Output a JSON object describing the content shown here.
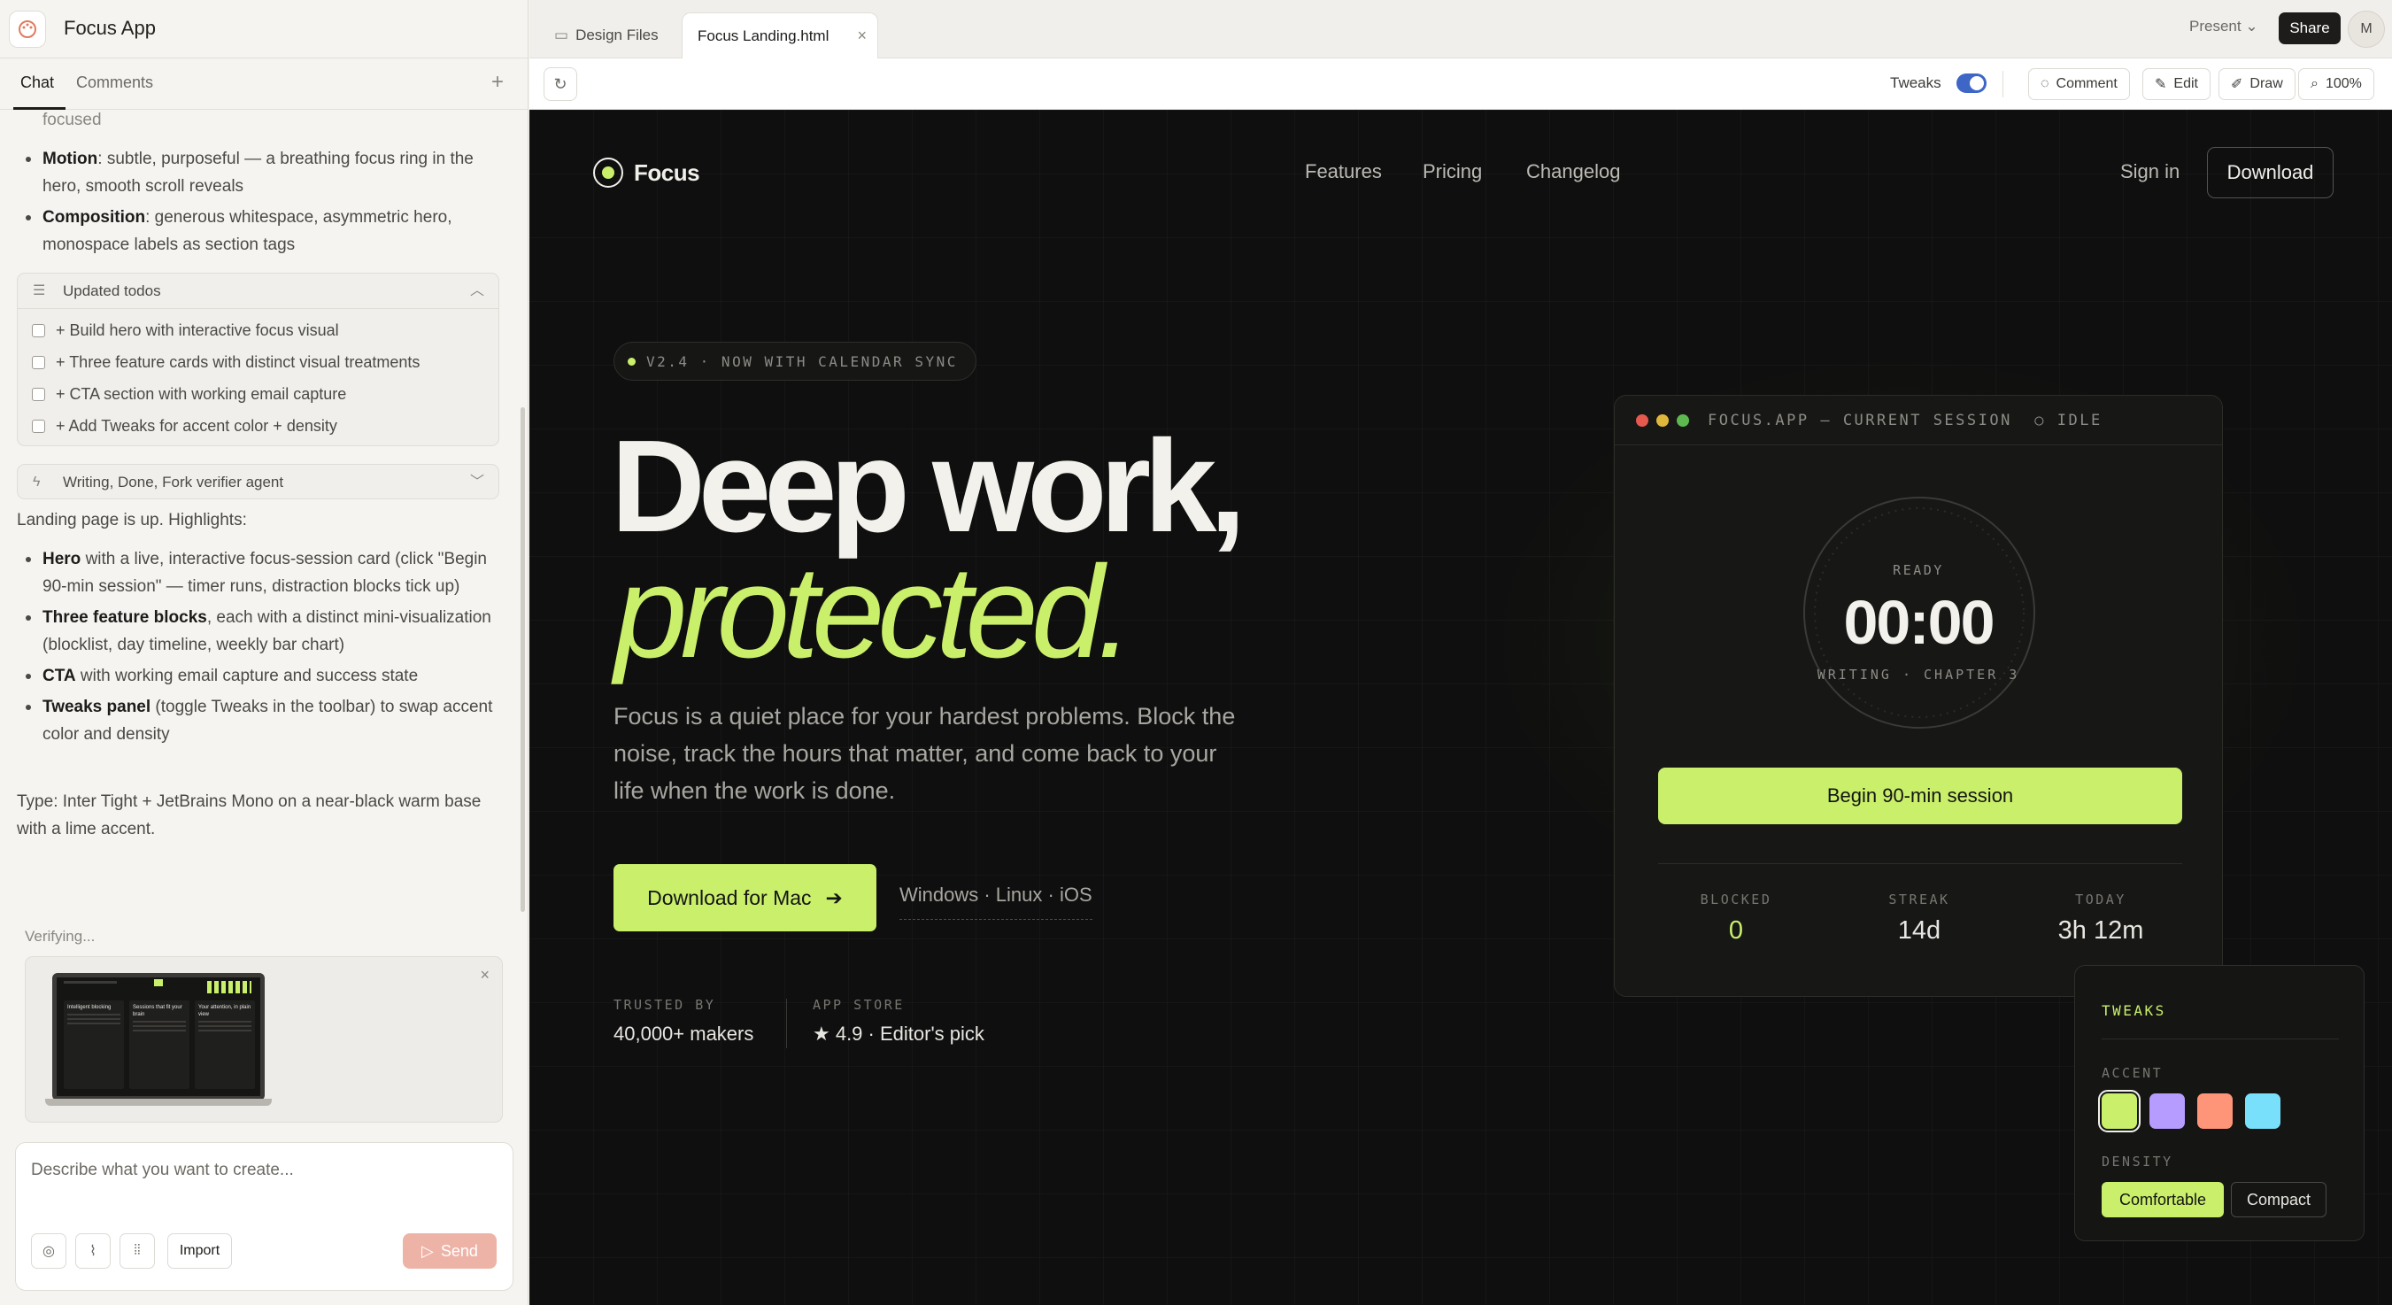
{
  "app": {
    "title": "Focus App"
  },
  "panel": {
    "tabs": [
      "Chat",
      "Comments"
    ],
    "plus": "+",
    "partial_top": "focused",
    "design_bullets": [
      {
        "bold": "Motion",
        "text": ": subtle, purposeful — a breathing focus ring in the hero, smooth scroll reveals"
      },
      {
        "bold": "Composition",
        "text": ": generous whitespace, asymmetric hero, monospace labels as section tags"
      }
    ],
    "todos": {
      "title": "Updated todos",
      "items": [
        "+ Build hero with interactive focus visual",
        "+ Three feature cards with distinct visual treatments",
        "+ CTA section with working email capture",
        "+ Add Tweaks for accent color + density"
      ]
    },
    "agent": {
      "title": "Writing, Done, Fork verifier agent"
    },
    "summary_intro": "Landing page is up. Highlights:",
    "highlights": [
      {
        "bold": "Hero",
        "text": " with a live, interactive focus-session card (click \"Begin 90-min session\" — timer runs, distraction blocks tick up)"
      },
      {
        "bold": "Three feature blocks",
        "text": ", each with a distinct mini-visualization (blocklist, day timeline, weekly bar chart)"
      },
      {
        "bold": "CTA",
        "text": " with working email capture and success state"
      },
      {
        "bold": "Tweaks panel",
        "text": " (toggle Tweaks in the toolbar) to swap accent color and density"
      }
    ],
    "type_note": "Type: Inter Tight + JetBrains Mono on a near-black warm base with a lime accent.",
    "verifying": "Verifying...",
    "thumb_cols": [
      "Intelligent blocking",
      "Sessions that fit your brain",
      "Your attention, in plain view"
    ],
    "input_placeholder": "Describe what you want to create...",
    "import_label": "Import",
    "send_label": "Send"
  },
  "topbar": {
    "tabs": [
      "Design Files",
      "Focus Landing.html"
    ],
    "present": "Present",
    "share": "Share",
    "avatar": "M"
  },
  "toolbar": {
    "tweaks": "Tweaks",
    "tweaks_on": true,
    "comment": "Comment",
    "edit": "Edit",
    "draw": "Draw",
    "zoom": "100%"
  },
  "site": {
    "brand": "Focus",
    "nav": [
      "Features",
      "Pricing",
      "Changelog"
    ],
    "signin": "Sign in",
    "download": "Download",
    "badge": "V2.4 · NOW WITH CALENDAR SYNC",
    "headline_1": "Deep work,",
    "headline_2": "protected.",
    "lede": "Focus is a quiet place for your hardest problems. Block the noise, track the hours that matter, and come back to your life when the work is done.",
    "cta_primary": "Download for Mac",
    "cta_alt": "Windows · Linux · iOS",
    "meta": [
      {
        "label": "TRUSTED BY",
        "value": "40,000+ makers"
      },
      {
        "label": "APP STORE",
        "value": "★ 4.9 · Editor's pick"
      }
    ],
    "session": {
      "title": "FOCUS.APP — CURRENT SESSION  ○ IDLE",
      "state": "READY",
      "time": "00:00",
      "task": "WRITING · CHAPTER 3",
      "button": "Begin 90-min session",
      "stats": [
        {
          "label": "BLOCKED",
          "value": "0"
        },
        {
          "label": "STREAK",
          "value": "14d"
        },
        {
          "label": "TODAY",
          "value": "3h 12m"
        }
      ]
    },
    "tweaks": {
      "title": "TWEAKS",
      "accent_label": "ACCENT",
      "accents": [
        "#c9ef6b",
        "#b69cff",
        "#ff9578",
        "#79e0fb"
      ],
      "density_label": "DENSITY",
      "density_options": [
        "Comfortable",
        "Compact"
      ],
      "density_selected": "Comfortable"
    },
    "colors": {
      "accent": "#c9ef6b",
      "background": "#0f0f0f"
    }
  }
}
